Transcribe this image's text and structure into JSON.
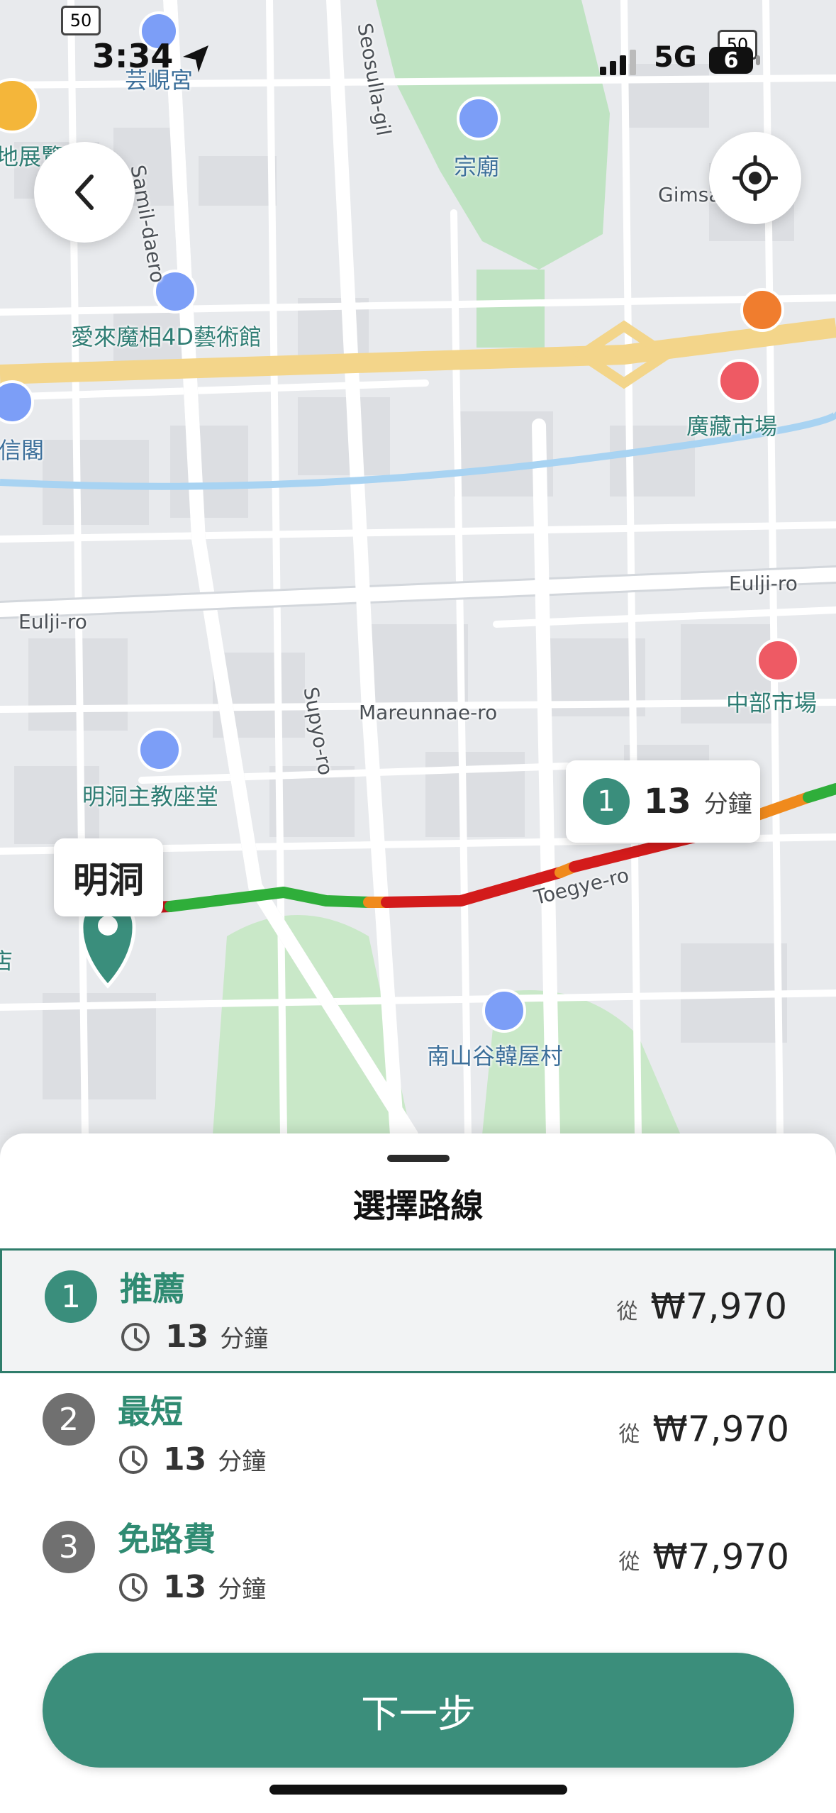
{
  "status_bar": {
    "time": "3:34",
    "network": "5G",
    "battery": "6"
  },
  "map": {
    "route_badge": {
      "number": "1",
      "minutes": "13",
      "unit": "分鐘"
    },
    "origin_label": "明洞",
    "road_signs": [
      "50",
      "50"
    ],
    "labels": {
      "poi_01": "芸峴宮",
      "poi_02": "宗廟",
      "poi_03": "愛來魔相4D藝術館",
      "poi_04": "廣藏市場",
      "poi_05": "信閣",
      "poi_06": "中部市場",
      "poi_07": "明洞主教座堂",
      "poi_08": "南山谷韓屋村",
      "poi_09": "地展覽",
      "poi_10": "店",
      "road_01": "Samil-daero",
      "road_02": "Seosulla-gil",
      "road_03": "Gimsa",
      "road_04": "Eulji-ro",
      "road_05": "Eulji-ro",
      "road_06": "Supyo-ro",
      "road_07": "Mareunnae-ro",
      "road_08": "Toegye-ro"
    }
  },
  "sheet": {
    "title": "選擇路線",
    "routes": [
      {
        "num": "1",
        "name": "推薦",
        "minutes": "13",
        "unit": "分鐘",
        "from": "從",
        "price": "₩7,970",
        "selected": true,
        "color": "#3a8e7c"
      },
      {
        "num": "2",
        "name": "最短",
        "minutes": "13",
        "unit": "分鐘",
        "from": "從",
        "price": "₩7,970",
        "selected": false,
        "color": "#707070"
      },
      {
        "num": "3",
        "name": "免路費",
        "minutes": "13",
        "unit": "分鐘",
        "from": "從",
        "price": "₩7,970",
        "selected": false,
        "color": "#707070"
      }
    ],
    "next_button": "下一步"
  },
  "colors": {
    "accent": "#3b8e7b",
    "traffic_free": "#2fae3a",
    "traffic_slow": "#f08a1c",
    "traffic_jam": "#d31b1b"
  },
  "icons": [
    "back-arrow-icon",
    "locate-icon",
    "clock-icon",
    "location-arrow-icon",
    "signal-icon",
    "poi-pin-icon",
    "museum-icon",
    "shopping-icon",
    "restaurant-icon",
    "origin-pin-icon"
  ]
}
